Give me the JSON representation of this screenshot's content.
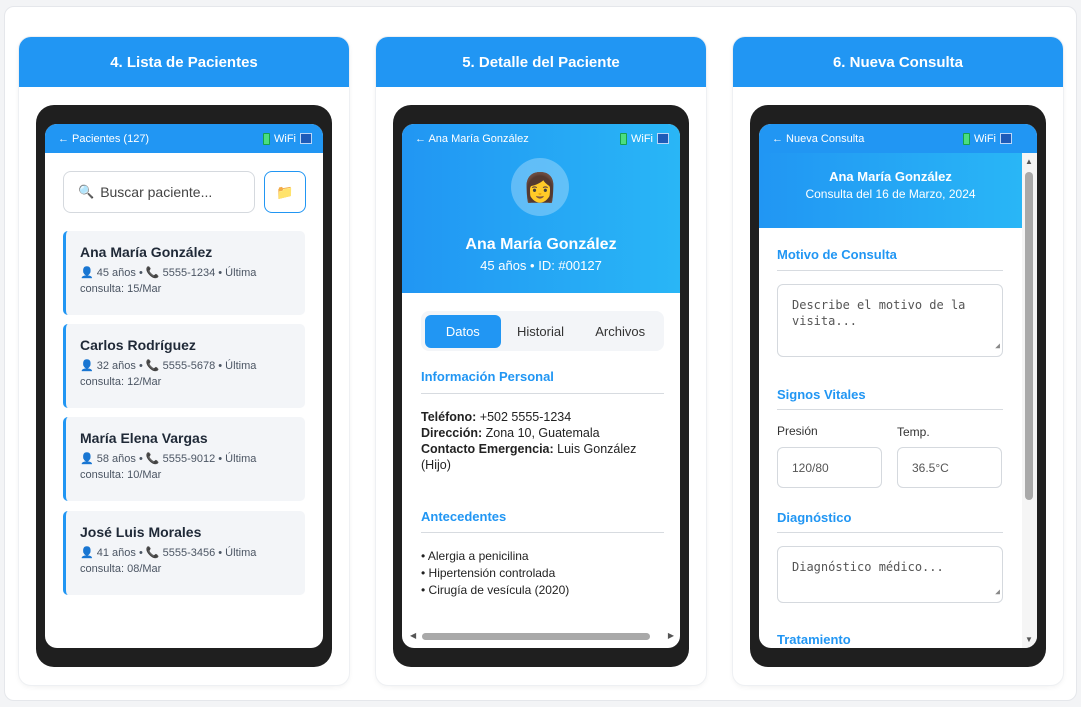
{
  "columns": [
    {
      "title": "4. Lista de Pacientes"
    },
    {
      "title": "5. Detalle del Paciente"
    },
    {
      "title": "6. Nueva Consulta"
    }
  ],
  "status": {
    "wifi": "WiFi",
    "signal": "📶"
  },
  "list_screen": {
    "back_title": "← Pacientes (127)",
    "search_icon": "🔍",
    "search_placeholder": "Buscar paciente...",
    "folder_icon": "📁",
    "patients": [
      {
        "name": "Ana María González",
        "meta": "👤 45 años • 📞 5555-1234 • Última consulta: 15/Mar"
      },
      {
        "name": "Carlos Rodríguez",
        "meta": "👤 32 años • 📞 5555-5678 • Última consulta: 12/Mar"
      },
      {
        "name": "María Elena Vargas",
        "meta": "👤 58 años • 📞 5555-9012 • Última consulta: 10/Mar"
      },
      {
        "name": "José Luis Morales",
        "meta": "👤 41 años • 📞 5555-3456 • Última consulta: 08/Mar"
      }
    ]
  },
  "detail_screen": {
    "back_title": "← Ana María González",
    "avatar": "👩",
    "name": "Ana María González",
    "subtitle": "45 años • ID: #00127",
    "tabs": [
      "Datos",
      "Historial",
      "Archivos"
    ],
    "personal_title": "Información Personal",
    "phone_label": "Teléfono:",
    "phone_value": " +502 5555-1234",
    "address_label": "Dirección:",
    "address_value": " Zona 10, Guatemala",
    "emergency_label": "Contacto Emergencia:",
    "emergency_value": " Luis González (Hijo)",
    "history_title": "Antecedentes",
    "history": [
      "• Alergia a penicilina",
      "• Hipertensión controlada",
      "• Cirugía de vesícula (2020)"
    ]
  },
  "consult_screen": {
    "back_title": "← Nueva Consulta",
    "patient": "Ana María González",
    "date": "Consulta del 16 de Marzo, 2024",
    "reason_title": "Motivo de Consulta",
    "reason_placeholder": "Describe el motivo de la visita...",
    "vitals_title": "Signos Vitales",
    "pressure_label": "Presión",
    "temp_label": "Temp.",
    "pressure_value": "120/80",
    "temp_value": "36.5°C",
    "diagnosis_title": "Diagnóstico",
    "diagnosis_placeholder": "Diagnóstico médico...",
    "treatment_title": "Tratamiento"
  }
}
